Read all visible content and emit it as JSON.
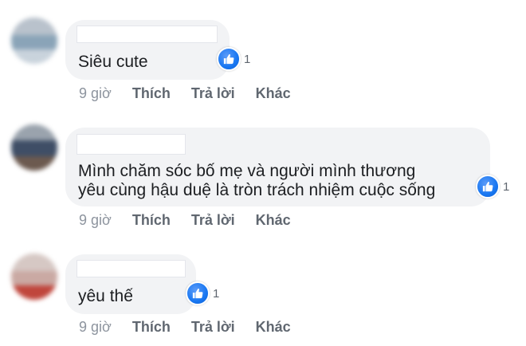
{
  "comments": [
    {
      "text_lines": [
        "Siêu cute"
      ],
      "reaction_icon": "like-icon",
      "reaction_count": "1",
      "time": "9 giờ",
      "like_label": "Thích",
      "reply_label": "Trả lời",
      "more_label": "Khác"
    },
    {
      "text_lines": [
        "Mình chăm sóc bố mẹ và người mình thương",
        "yêu cùng hậu duệ là tròn trách nhiệm cuộc sống"
      ],
      "reaction_icon": "like-icon",
      "reaction_count": "1",
      "time": "9 giờ",
      "like_label": "Thích",
      "reply_label": "Trả lời",
      "more_label": "Khác"
    },
    {
      "text_lines": [
        "yêu thế"
      ],
      "reaction_icon": "like-icon",
      "reaction_count": "1",
      "time": "9 giờ",
      "like_label": "Thích",
      "reply_label": "Trả lời",
      "more_label": "Khác"
    }
  ],
  "colors": {
    "bubble_bg": "#f2f3f5",
    "like_blue": "#1877f2",
    "meta_text": "#606770"
  }
}
